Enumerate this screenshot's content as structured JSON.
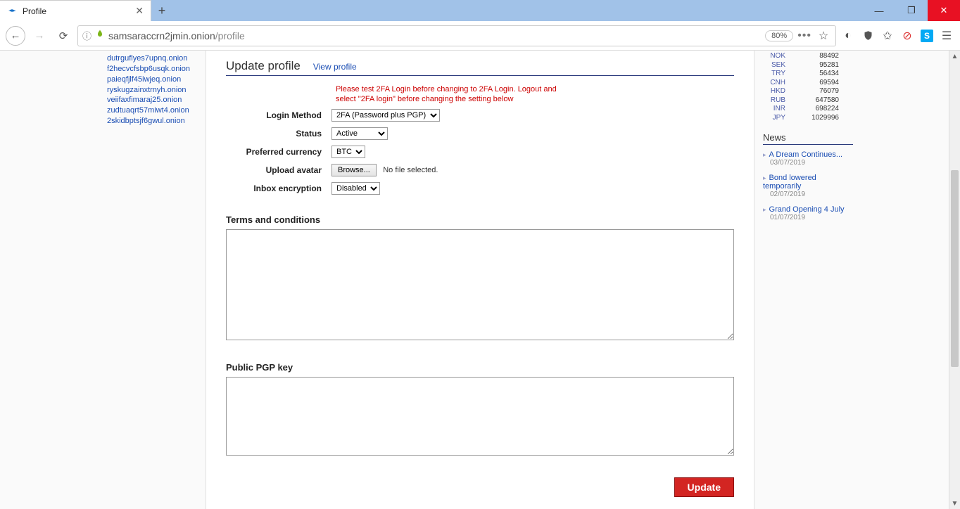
{
  "window": {
    "tab_title": "Profile",
    "new_tab_tooltip": "+"
  },
  "url": {
    "host": "samsaraccrn2jmin.onion",
    "path": "/profile",
    "zoom": "80%"
  },
  "sidebar": {
    "links": [
      "dutrguflyes7upnq.onion",
      "f2hecvcfsbp6usqk.onion",
      "paieqfjlf45iwjeq.onion",
      "ryskugzainxtrnyh.onion",
      "veiifaxfimaraj25.onion",
      "zudtuaqrt57miwt4.onion",
      "2skidbptsjf6gwul.onion"
    ]
  },
  "main": {
    "heading": "Update profile",
    "view_link": "View profile",
    "warning": "Please test 2FA Login before changing to 2FA Login. Logout and select \"2FA login\" before changing the setting below",
    "fields": {
      "login_method": {
        "label": "Login Method",
        "value": "2FA (Password plus PGP)"
      },
      "status": {
        "label": "Status",
        "value": "Active"
      },
      "currency": {
        "label": "Preferred currency",
        "value": "BTC"
      },
      "avatar": {
        "label": "Upload avatar",
        "browse": "Browse...",
        "nofile": "No file selected."
      },
      "inbox": {
        "label": "Inbox encryption",
        "value": "Disabled"
      }
    },
    "terms_heading": "Terms and conditions",
    "pgp_heading": "Public PGP key",
    "submit": "Update"
  },
  "rates": [
    {
      "code": "NOK",
      "value": "88492"
    },
    {
      "code": "SEK",
      "value": "95281"
    },
    {
      "code": "TRY",
      "value": "56434"
    },
    {
      "code": "CNH",
      "value": "69594"
    },
    {
      "code": "HKD",
      "value": "76079"
    },
    {
      "code": "RUB",
      "value": "647580"
    },
    {
      "code": "INR",
      "value": "698224"
    },
    {
      "code": "JPY",
      "value": "1029996"
    }
  ],
  "news": {
    "heading": "News",
    "items": [
      {
        "title": "A Dream Continues...",
        "date": "03/07/2019"
      },
      {
        "title": "Bond lowered temporarily",
        "date": "02/07/2019"
      },
      {
        "title": "Grand Opening 4 July",
        "date": "01/07/2019"
      }
    ]
  }
}
